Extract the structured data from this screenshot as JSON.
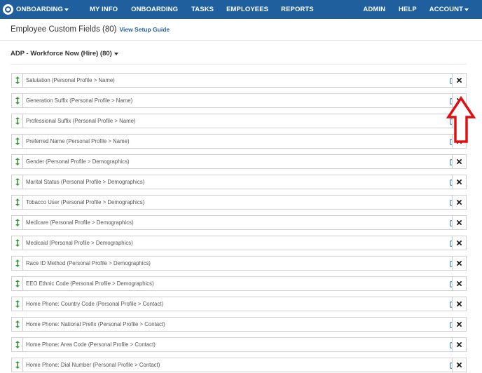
{
  "nav": {
    "brand_label": "ONBOARDING",
    "items": [
      "MY INFO",
      "ONBOARDING",
      "TASKS",
      "EMPLOYEES",
      "REPORTS"
    ],
    "right_items": [
      "ADMIN",
      "HELP"
    ],
    "account_label": "ACCOUNT"
  },
  "header": {
    "title": "Employee Custom Fields (80)",
    "setup_link": "View Setup Guide"
  },
  "section": {
    "title": "ADP - Workforce Now (Hire) (80)"
  },
  "fields": [
    "Salutation (Personal Profile > Name)",
    "Generation Suffix (Personal Profile > Name)",
    "Professional Suffix (Personal Profile > Name)",
    "Preferred Name (Personal Profile > Name)",
    "Gender (Personal Profile > Demographics)",
    "Marital Status (Personal Profile > Demographics)",
    "Tobacco User (Personal Profile > Demographics)",
    "Medicare (Personal Profile > Demographics)",
    "Medicaid (Personal Profile > Demographics)",
    "Race ID Method (Personal Profile > Demographics)",
    "EEO Ethnic Code (Personal Profile > Demographics)",
    "Home Phone: Country Code (Personal Profile > Contact)",
    "Home Phone: National Prefix (Personal Profile > Contact)",
    "Home Phone: Area Code (Personal Profile > Contact)",
    "Home Phone: Dial Number (Personal Profile > Contact)"
  ],
  "icons": {
    "drag": "up-down-arrow-icon",
    "edit": "edit-icon",
    "delete": "close-icon",
    "annotation": "red-up-arrow-annotation"
  },
  "colors": {
    "nav_bg": "#1f5f9e",
    "drag_icon": "#3a9a3a",
    "edit_icon": "#1f6fb0",
    "annotation": "#e01010"
  }
}
